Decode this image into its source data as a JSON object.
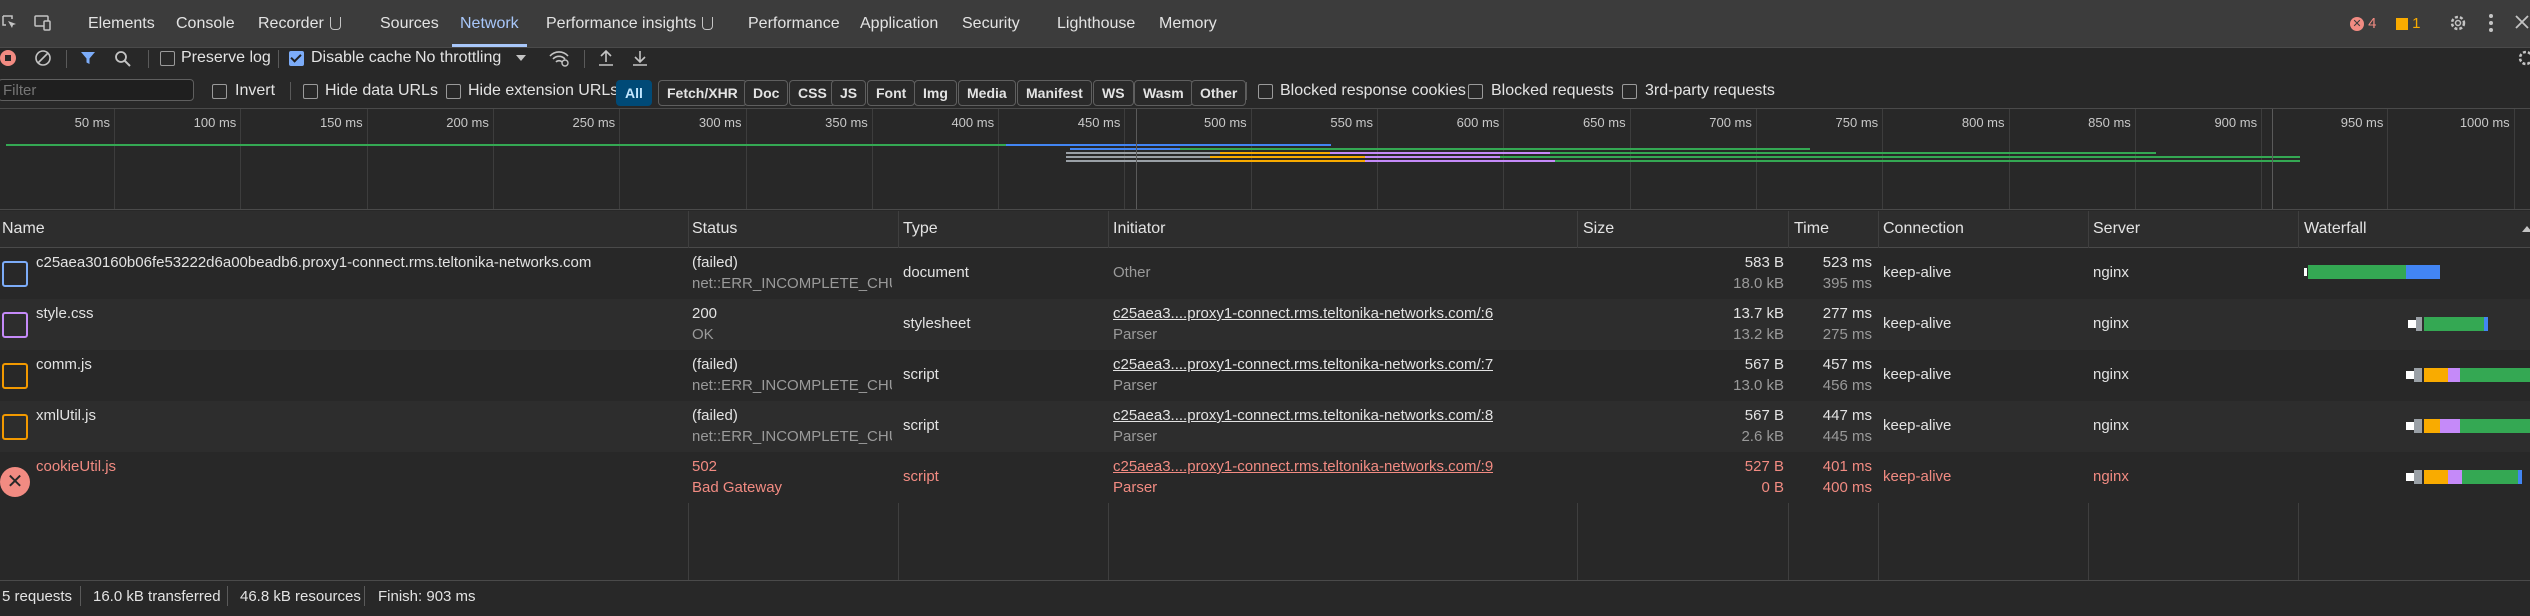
{
  "tabs": [
    "Elements",
    "Console",
    "Recorder",
    "Sources",
    "Network",
    "Performance insights",
    "Performance",
    "Application",
    "Security",
    "Lighthouse",
    "Memory"
  ],
  "badges": {
    "errors": "4",
    "warnings": "1"
  },
  "toolbar": {
    "preserve_log": "Preserve log",
    "disable_cache": "Disable cache",
    "throttling": "No throttling",
    "preserve_checked": false,
    "disable_cache_checked": true
  },
  "filterbar": {
    "placeholder": "Filter",
    "invert": "Invert",
    "hide_data": "Hide data URLs",
    "hide_ext": "Hide extension URLs",
    "chips": [
      "All",
      "Fetch/XHR",
      "Doc",
      "CSS",
      "JS",
      "Font",
      "Img",
      "Media",
      "Manifest",
      "WS",
      "Wasm",
      "Other"
    ],
    "blocked_cookies": "Blocked response cookies",
    "blocked_requests": "Blocked requests",
    "third_party": "3rd-party requests"
  },
  "overview": {
    "ticks": [
      "50 ms",
      "100 ms",
      "150 ms",
      "200 ms",
      "250 ms",
      "300 ms",
      "350 ms",
      "400 ms",
      "450 ms",
      "500 ms",
      "550 ms",
      "600 ms",
      "650 ms",
      "700 ms",
      "750 ms",
      "800 ms",
      "850 ms",
      "900 ms",
      "950 ms",
      "1000 ms"
    ]
  },
  "columns": {
    "name": "Name",
    "status": "Status",
    "type": "Type",
    "initiator": "Initiator",
    "size": "Size",
    "time": "Time",
    "connection": "Connection",
    "server": "Server",
    "waterfall": "Waterfall"
  },
  "rows": [
    {
      "name": "c25aea30160b06fe53222d6a00beadb6.proxy1-connect.rms.teltonika-networks.com",
      "status": "(failed)",
      "status_sub": "net::ERR_INCOMPLETE_CHU...",
      "type": "document",
      "initiator": "Other",
      "initiator_sub": "",
      "size": "583 B",
      "size_sub": "18.0 kB",
      "time": "523 ms",
      "time_sub": "395 ms",
      "connection": "keep-alive",
      "server": "nginx",
      "icon": "document-icon",
      "error": false
    },
    {
      "name": "style.css",
      "status": "200",
      "status_sub": "OK",
      "type": "stylesheet",
      "initiator": "c25aea3....proxy1-connect.rms.teltonika-networks.com/:6",
      "initiator_sub": "Parser",
      "size": "13.7 kB",
      "size_sub": "13.2 kB",
      "time": "277 ms",
      "time_sub": "275 ms",
      "connection": "keep-alive",
      "server": "nginx",
      "icon": "stylesheet-icon",
      "error": false
    },
    {
      "name": "comm.js",
      "status": "(failed)",
      "status_sub": "net::ERR_INCOMPLETE_CHU...",
      "type": "script",
      "initiator": "c25aea3....proxy1-connect.rms.teltonika-networks.com/:7",
      "initiator_sub": "Parser",
      "size": "567 B",
      "size_sub": "13.0 kB",
      "time": "457 ms",
      "time_sub": "456 ms",
      "connection": "keep-alive",
      "server": "nginx",
      "icon": "script-icon",
      "error": false
    },
    {
      "name": "xmlUtil.js",
      "status": "(failed)",
      "status_sub": "net::ERR_INCOMPLETE_CHU...",
      "type": "script",
      "initiator": "c25aea3....proxy1-connect.rms.teltonika-networks.com/:8",
      "initiator_sub": "Parser",
      "size": "567 B",
      "size_sub": "2.6 kB",
      "time": "447 ms",
      "time_sub": "445 ms",
      "connection": "keep-alive",
      "server": "nginx",
      "icon": "script-icon",
      "error": false
    },
    {
      "name": "cookieUtil.js",
      "status": "502",
      "status_sub": "Bad Gateway",
      "type": "script",
      "initiator": "c25aea3....proxy1-connect.rms.teltonika-networks.com/:9",
      "initiator_sub": "Parser",
      "size": "527 B",
      "size_sub": "0 B",
      "time": "401 ms",
      "time_sub": "400 ms",
      "connection": "keep-alive",
      "server": "nginx",
      "icon": "error-icon",
      "error": true
    }
  ],
  "footer": {
    "requests": "5 requests",
    "transferred": "16.0 kB transferred",
    "resources": "46.8 kB resources",
    "finish": "Finish: 903 ms"
  },
  "colors": {
    "accent": "#a8c7fa",
    "error": "#f28b82",
    "green": "#34a853",
    "blue": "#4285f4",
    "purple": "#c58af9",
    "orange": "#f9ab00"
  }
}
